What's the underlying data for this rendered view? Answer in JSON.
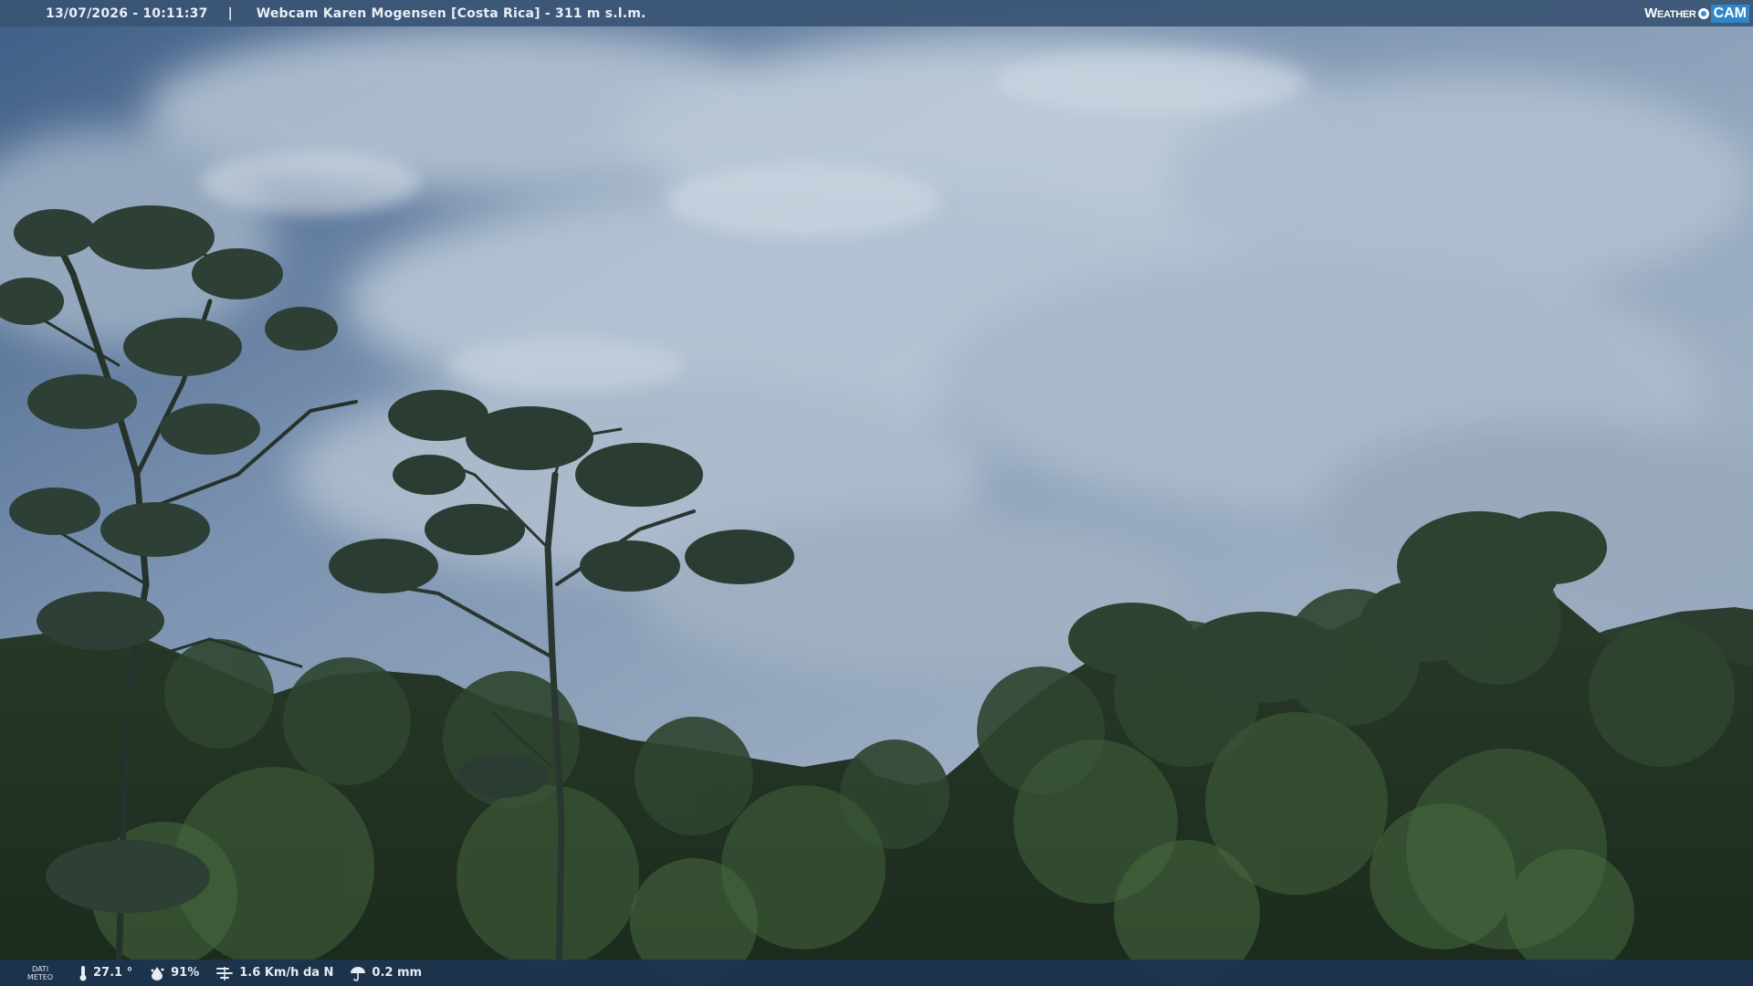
{
  "header": {
    "datetime": "13/07/2026 - 10:11:37",
    "separator": "|",
    "title": "Webcam Karen Mogensen [Costa Rica] - 311 m s.l.m."
  },
  "logo": {
    "weather": "Weather",
    "cam": "CAM"
  },
  "meteo": {
    "label_line1": "DATI",
    "label_line2": "METEO",
    "temperature": "27.1 °",
    "humidity": "91%",
    "wind": "1.6 Km/h da N",
    "rain": "0.2 mm"
  },
  "colors": {
    "header_bg": "#3a5474",
    "footer_bg": "#1c3450",
    "logo_accent": "#2f86c8"
  },
  "icons": {
    "temperature": "thermometer-icon",
    "humidity": "humidity-icon",
    "wind": "wind-icon",
    "rain": "rain-icon"
  }
}
